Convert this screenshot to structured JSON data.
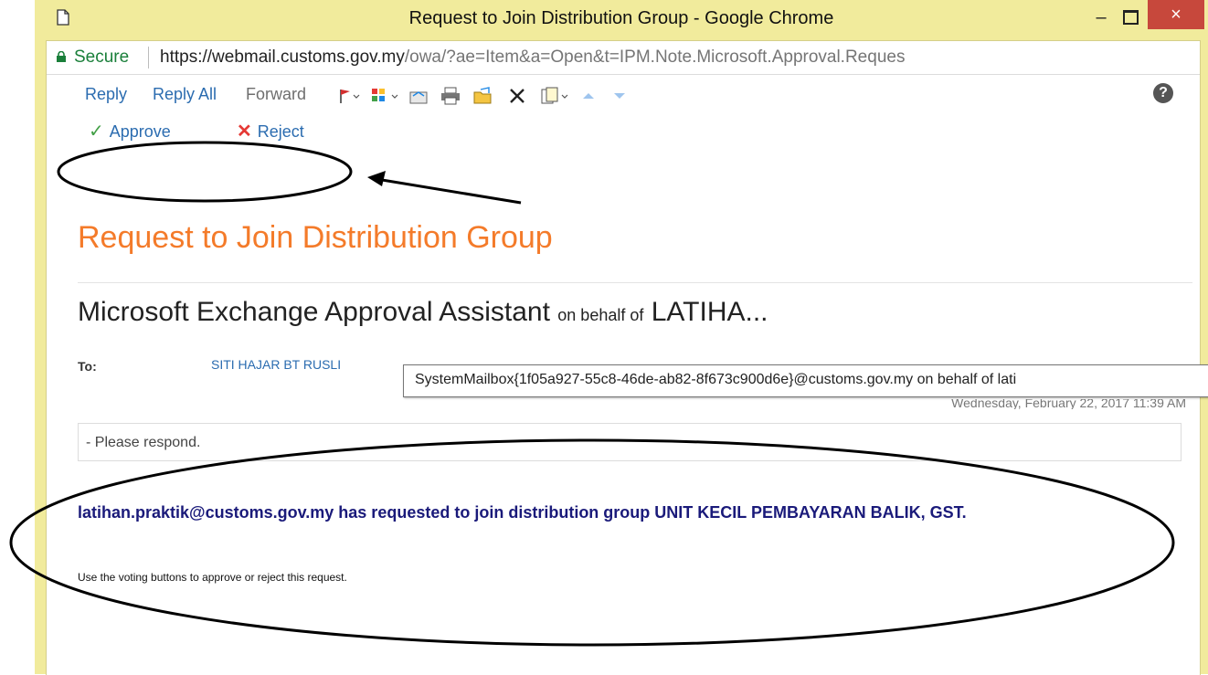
{
  "window": {
    "title": "Request to Join Distribution Group - Google Chrome",
    "minimize": "–",
    "close": "×"
  },
  "addressbar": {
    "secure_label": "Secure",
    "url_host": "https://webmail.customs.gov.my",
    "url_path": "/owa/?ae=Item&a=Open&t=IPM.Note.Microsoft.Approval.Reques"
  },
  "toolbar": {
    "reply": "Reply",
    "reply_all": "Reply All",
    "forward": "Forward",
    "help": "?"
  },
  "voting": {
    "approve": "Approve",
    "reject": "Reject"
  },
  "message": {
    "subject": "Request to Join Distribution Group",
    "from_name": "Microsoft Exchange Approval Assistant",
    "on_behalf": "on behalf of",
    "from_behalf_name": "LATIHA...",
    "to_label": "To:",
    "to_value": "SITI HAJAR BT RUSLI",
    "tooltip": "SystemMailbox{1f05a927-55c8-46de-ab82-8f673c900d6e}@customs.gov.my on behalf of lati",
    "date": "Wednesday, February 22, 2017 11:39 AM",
    "respond": "- Please respond.",
    "body_main": "latihan.praktik@customs.gov.my has requested to join distribution group UNIT KECIL PEMBAYARAN BALIK, GST.",
    "body_sub": "Use the voting buttons to approve or reject this request."
  },
  "colors": {
    "chrome_frame": "#f1eb9c",
    "close_button": "#c7483c",
    "subject": "#f47b2a",
    "link": "#2b6cb0",
    "body_text": "#1a1a7a"
  }
}
